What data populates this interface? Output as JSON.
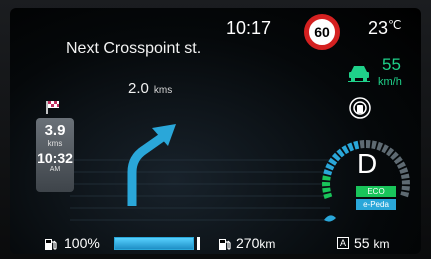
{
  "status": {
    "clock": "10:17",
    "speed_limit": "60",
    "temperature": "23",
    "temperature_unit": "℃"
  },
  "navigation": {
    "next_street": "Next Crosspoint st.",
    "distance": "2.0",
    "distance_unit": "kms",
    "turn_icon": "turn-right-arrow-icon"
  },
  "trip": {
    "flag_icon": "checkered-flag-icon",
    "distance": "3.9",
    "distance_unit": "kms",
    "eta": "10:32",
    "eta_period": "AM"
  },
  "cruise": {
    "car_icon": "car-icon",
    "speed": "55",
    "unit": "km/h",
    "sensor_icon": "radar-sensor-icon"
  },
  "drive": {
    "gear": "D",
    "mode_eco": "ECO",
    "mode_epedal": "e-Peda",
    "power_gauge_level": 0.45
  },
  "fuel": {
    "percent_label": "100%",
    "level": 1.0,
    "range": "270",
    "range_unit": "km",
    "avg_icon_label": "A",
    "avg_speed": "55",
    "avg_unit": "km"
  },
  "colors": {
    "accent_blue": "#2aa7d9",
    "accent_green": "#1fd18a",
    "speed_sign_red": "#d42020"
  }
}
